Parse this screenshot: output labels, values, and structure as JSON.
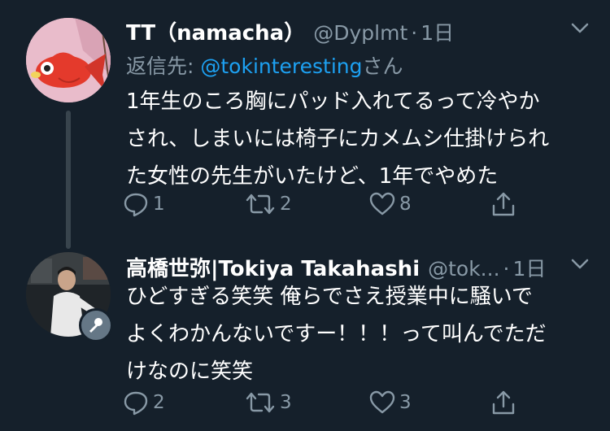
{
  "colors": {
    "background": "#15202b",
    "text_primary": "#ffffff",
    "text_secondary": "#8899a6",
    "link": "#1da1f2",
    "thread_line": "#38444d"
  },
  "tweets": [
    {
      "name": "TT（namacha）",
      "handle": "@Dyplmt",
      "dot": "·",
      "time": "1日",
      "reply_prefix": "返信先: ",
      "reply_mention": "@tokinteresting",
      "reply_suffix": "さん",
      "text": "1年生のころ胸にパッド入れてるって冷やか\nされ、しまいには椅子にカメムシ仕掛けられ\nた女性の先生がいたけど、1年でやめた",
      "replies": "1",
      "retweets": "2",
      "likes": "8",
      "avatar_icon": "fish-avatar"
    },
    {
      "name": "高橋世弥|Tokiya Takahashi",
      "handle": "@tok...",
      "dot": "·",
      "time": "1日",
      "text": "ひどすぎる笑笑 俺らでさえ授業中に騒いで\nよくわかんないですー！！！って叫んでただ\nけなのに笑笑",
      "replies": "2",
      "retweets": "3",
      "likes": "3",
      "avatar_icon": "person-photo-avatar",
      "badge_icon": "microphone-icon"
    }
  ]
}
